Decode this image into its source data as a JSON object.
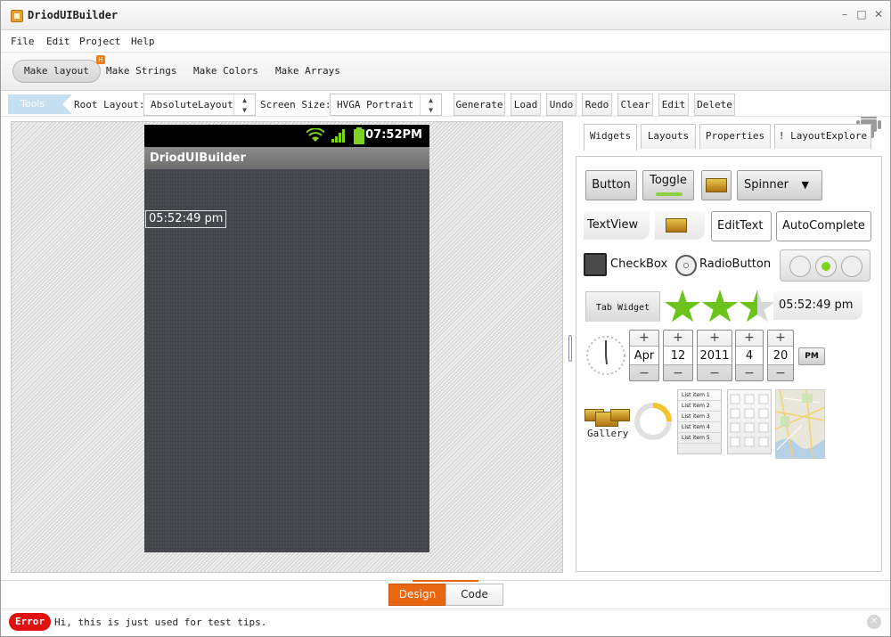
{
  "app": {
    "title": "DriodUIBuilder"
  },
  "window_controls": {
    "minimize": "–",
    "maximize": "□",
    "close": "✕"
  },
  "menu": [
    "File",
    "Edit",
    "Project",
    "Help"
  ],
  "make_tabs": {
    "items": [
      "Make layout",
      "Make Strings",
      "Make Colors",
      "Make Arrays"
    ],
    "active": "Make layout",
    "badge": "H"
  },
  "toolbar": {
    "tools_label": "Tools",
    "root_layout_label": "Root Layout:",
    "root_layout_value": "AbsoluteLayout",
    "screen_size_label": "Screen Size:",
    "screen_size_value": "HVGA Portrait",
    "buttons": [
      "Generate",
      "Load",
      "Undo",
      "Redo",
      "Clear",
      "Edit",
      "Delete"
    ]
  },
  "phone": {
    "status_time": "07:52PM",
    "app_title": "DriodUIBuilder",
    "textview_text": "05:52:49 pm",
    "bg_color": "#45474c"
  },
  "right_tabs": {
    "items": [
      "Widgets",
      "Layouts",
      "Properties",
      "LayoutExplore"
    ],
    "active": "Widgets",
    "explore_glyph": "!"
  },
  "widgets": {
    "button": "Button",
    "toggle": "Toggle",
    "spinner": "Spinner",
    "spinner_arrow": "▼",
    "textview": "TextView",
    "edittext": "EditText",
    "autocomplete": "AutoComplete",
    "checkbox": "CheckBox",
    "radiobutton": "RadioButton",
    "tab_widget": "Tab Widget",
    "digital_clock": "05:52:49 pm",
    "rating_stars": 2.5,
    "pickers": [
      {
        "value": "Apr",
        "plus": "+",
        "minus": "−"
      },
      {
        "value": "12",
        "plus": "+",
        "minus": "−"
      },
      {
        "value": "2011",
        "plus": "+",
        "minus": "−"
      },
      {
        "value": "4",
        "plus": "+",
        "minus": "−"
      },
      {
        "value": "20",
        "plus": "+",
        "minus": "−"
      }
    ],
    "ampm": "PM",
    "gallery": "Gallery",
    "list_items": [
      "List item 1",
      "List item 2",
      "List item 3",
      "List item 4",
      "List item 5"
    ]
  },
  "bottom": {
    "design": "Design",
    "code": "Code",
    "active": "Design"
  },
  "status": {
    "badge": "Error",
    "message": "Hi, this is just used for test tips.",
    "close": "✕"
  },
  "colors": {
    "accent_orange": "#e8660f",
    "error_red": "#e01010",
    "star_green": "#6cc31c",
    "tools_blue": "#c6dff1"
  }
}
